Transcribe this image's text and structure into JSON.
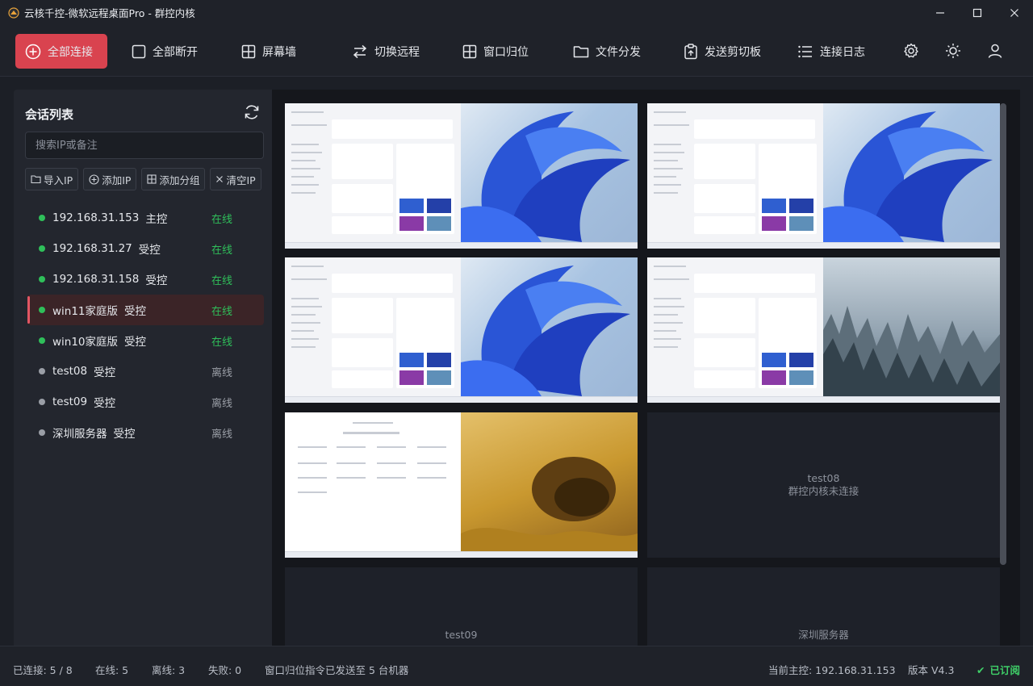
{
  "window": {
    "title": "云核千控-微软远程桌面Pro - 群控内核",
    "controls": [
      "minimize-icon",
      "maximize-icon",
      "close-icon"
    ]
  },
  "toolbar": {
    "connect_all": "全部连接",
    "disconnect_all": "全部断开",
    "screen_wall": "屏幕墙",
    "switch_remote": "切换远程",
    "window_reset": "窗口归位",
    "file_distribute": "文件分发",
    "send_clipboard": "发送剪切板",
    "connection_log": "连接日志",
    "icons": [
      "settings-gear-icon",
      "theme-sun-icon",
      "user-icon"
    ]
  },
  "sidebar": {
    "title": "会话列表",
    "search_placeholder": "搜索IP或备注",
    "actions": {
      "import": "导入IP",
      "add": "添加IP",
      "add_group": "添加分组",
      "clear": "清空IP"
    },
    "sessions": [
      {
        "name": "192.168.31.153",
        "role": "主控",
        "status": "在线",
        "online": true
      },
      {
        "name": "192.168.31.27",
        "role": "受控",
        "status": "在线",
        "online": true
      },
      {
        "name": "192.168.31.158",
        "role": "受控",
        "status": "在线",
        "online": true
      },
      {
        "name": "win11家庭版",
        "role": "受控",
        "status": "在线",
        "online": true,
        "active": true
      },
      {
        "name": "win10家庭版",
        "role": "受控",
        "status": "在线",
        "online": true
      },
      {
        "name": "test08",
        "role": "受控",
        "status": "离线",
        "online": false
      },
      {
        "name": "test09",
        "role": "受控",
        "status": "离线",
        "online": false
      },
      {
        "name": "深圳服务器",
        "role": "受控",
        "status": "离线",
        "online": false
      }
    ]
  },
  "wall": {
    "tiles": [
      {
        "type": "win11",
        "selected": true
      },
      {
        "type": "win11"
      },
      {
        "type": "win11"
      },
      {
        "type": "forest"
      },
      {
        "type": "desert"
      },
      {
        "type": "placeholder",
        "name": "test08",
        "message": "群控内核未连接"
      },
      {
        "type": "placeholder",
        "name": "test09",
        "message": ""
      },
      {
        "type": "placeholder",
        "name": "深圳服务器",
        "message": ""
      }
    ]
  },
  "statusbar": {
    "connected": "已连接: 5 / 8",
    "online": "在线: 5",
    "offline": "离线: 3",
    "failed": "失败: 0",
    "message": "窗口归位指令已发送至 5 台机器",
    "current_master": "当前主控: 192.168.31.153",
    "version": "版本 V4.3",
    "license": "已订阅"
  },
  "colors": {
    "accent_red": "#d9434f",
    "online_green": "#2fbf5a",
    "offline_gray": "#9a9ea6",
    "selection_blue": "#3f7ae8"
  }
}
